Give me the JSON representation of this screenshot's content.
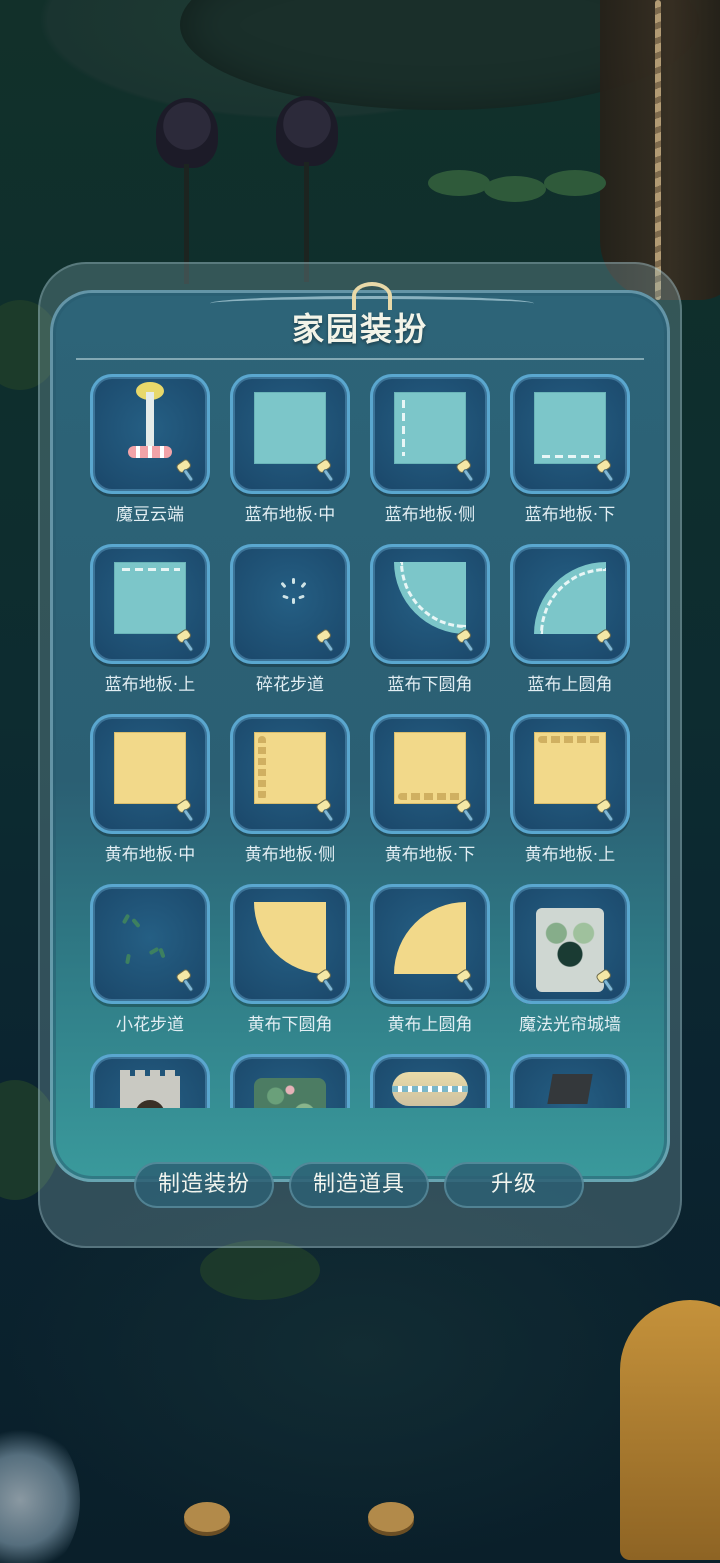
{
  "panel": {
    "title": "家园装扮"
  },
  "items": [
    {
      "label": "魔豆云端",
      "art": "tower"
    },
    {
      "label": "蓝布地板·中",
      "art": "blue-square"
    },
    {
      "label": "蓝布地板·侧",
      "art": "blue-square-side"
    },
    {
      "label": "蓝布地板·下",
      "art": "blue-square-bottom"
    },
    {
      "label": "蓝布地板·上",
      "art": "blue-square-top"
    },
    {
      "label": "碎花步道",
      "art": "sparkle"
    },
    {
      "label": "蓝布下圆角",
      "art": "blue-corner-down"
    },
    {
      "label": "蓝布上圆角",
      "art": "blue-corner-up"
    },
    {
      "label": "黄布地板·中",
      "art": "yellow-square"
    },
    {
      "label": "黄布地板·侧",
      "art": "yellow-square-side"
    },
    {
      "label": "黄布地板·下",
      "art": "yellow-square-bottom"
    },
    {
      "label": "黄布地板·上",
      "art": "yellow-square-top"
    },
    {
      "label": "小花步道",
      "art": "leaves"
    },
    {
      "label": "黄布下圆角",
      "art": "yellow-corner-down"
    },
    {
      "label": "黄布上圆角",
      "art": "yellow-corner-up"
    },
    {
      "label": "魔法光帘城墙",
      "art": "magic-wall"
    },
    {
      "label": "",
      "art": "castle"
    },
    {
      "label": "",
      "art": "vine"
    },
    {
      "label": "",
      "art": "bench"
    },
    {
      "label": "",
      "art": "pole"
    }
  ],
  "buttons": {
    "make_decor": "制造装扮",
    "make_tool": "制造道具",
    "upgrade": "升级"
  },
  "colors": {
    "accent": "#5aa7cf",
    "blue_fabric": "#7cc6c9",
    "yellow_fabric": "#f2d98a"
  }
}
